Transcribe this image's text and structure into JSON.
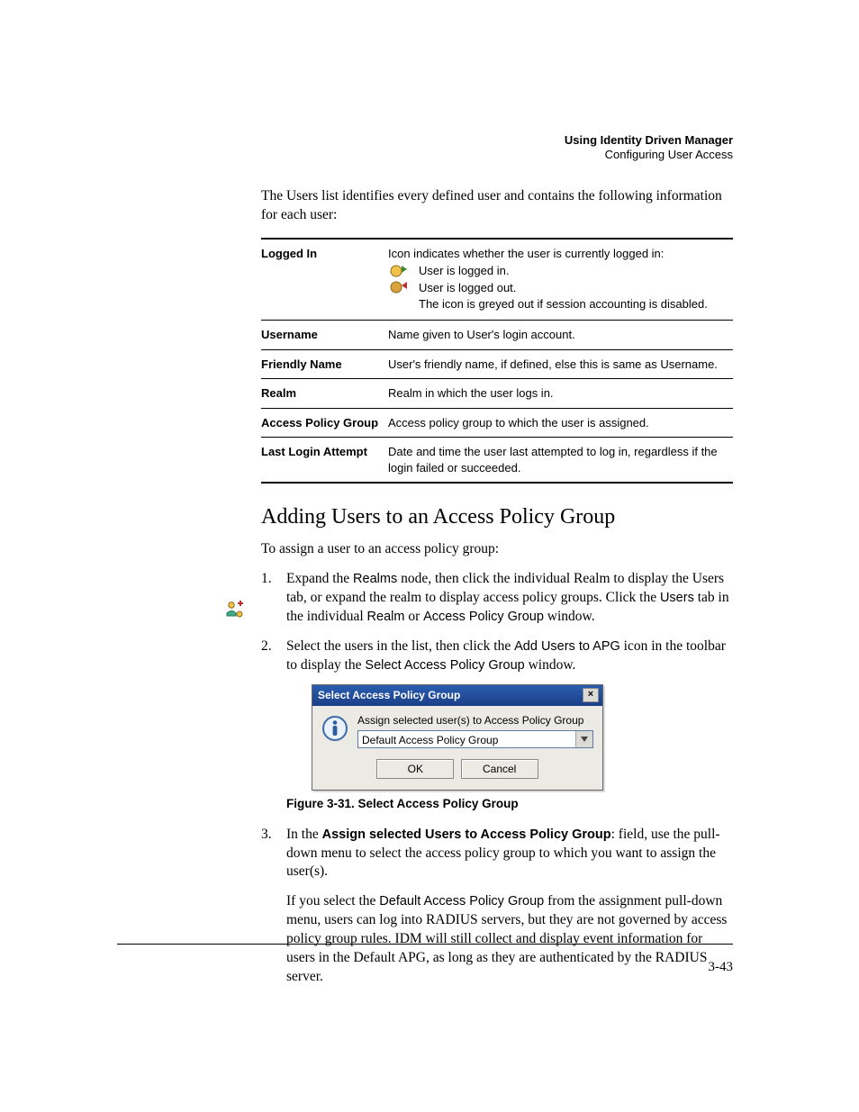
{
  "header": {
    "title": "Using Identity Driven Manager",
    "subtitle": "Configuring User Access"
  },
  "intro": "The Users list identifies every defined user and contains the following information for each user:",
  "fields": {
    "logged_in": {
      "term": "Logged In",
      "lead": "Icon indicates whether the user is currently logged in:",
      "line_in": "User is logged in.",
      "line_out": "User is logged out.",
      "line_grey": "The icon is greyed out if session accounting is disabled."
    },
    "username": {
      "term": "Username",
      "desc": "Name given to User's login account."
    },
    "friendly": {
      "term": "Friendly Name",
      "desc": "User's friendly name, if defined, else this is same as Username."
    },
    "realm": {
      "term": "Realm",
      "desc": "Realm in which the user logs in."
    },
    "apg": {
      "term": "Access Policy Group",
      "desc": "Access policy group to which the user is assigned."
    },
    "last": {
      "term": "Last Login Attempt",
      "desc": "Date and time the user last attempted to log in, regardless if the login failed or succeeded."
    }
  },
  "section_heading": "Adding Users to an Access Policy Group",
  "section_intro": "To assign a user to an access policy group:",
  "steps": {
    "one": {
      "num": "1.",
      "a": "Expand the ",
      "realms": "Realms",
      "b": " node, then click the individual Realm to display the Users tab, or expand the realm to display access policy groups. Click the ",
      "users": "Users",
      "c": " tab in the individual ",
      "realm_singular": "Realm",
      "d": " or ",
      "apg": "Access Policy Group",
      "e": " window."
    },
    "two": {
      "num": "2.",
      "a": "Select the users in the list, then click the ",
      "tool": "Add Users to APG",
      "b": " icon in the toolbar to display the ",
      "win": "Select Access Policy Group",
      "c": " window."
    },
    "three": {
      "num": "3.",
      "a": "In the ",
      "label": "Assign selected Users to Access Policy Group",
      "b": ": field, use the pull-down menu to select the access policy group to which you want to assign the user(s).",
      "para2a": "If you select the ",
      "default_apg": "Default Access Policy Group",
      "para2b": " from the assignment pull-down menu, users can log into RADIUS servers, but they are not governed by access policy group rules. IDM will still collect and display event information for users in the Default APG, as long as they are authenticated by the RADIUS server."
    }
  },
  "dialog": {
    "title": "Select Access Policy Group",
    "close": "×",
    "label": "Assign selected user(s) to Access Policy Group",
    "value": "Default Access Policy Group",
    "ok": "OK",
    "cancel": "Cancel"
  },
  "figure_caption": "Figure 3-31. Select Access Policy Group",
  "page_number": "3-43"
}
